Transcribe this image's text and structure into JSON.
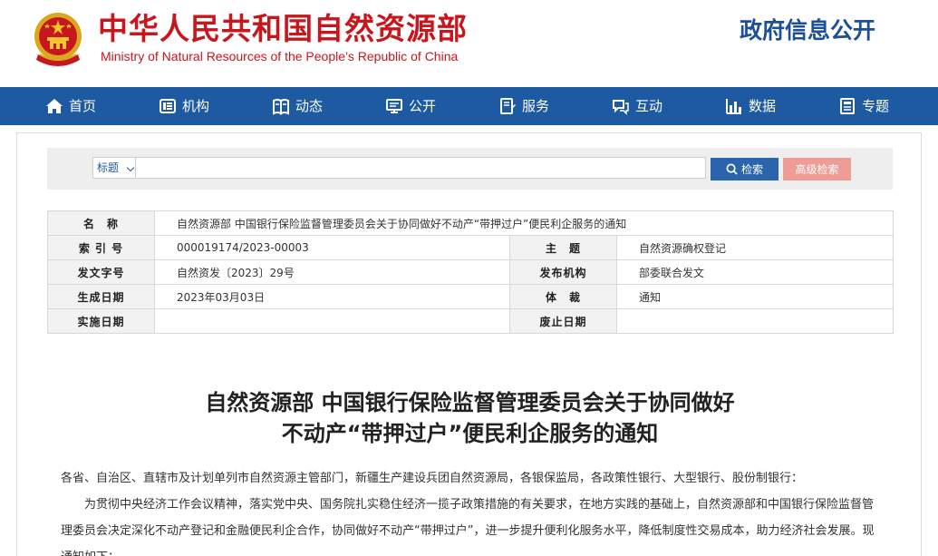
{
  "header": {
    "title": "中华人民共和国自然资源部",
    "subtitle": "Ministry of Natural Resources of the People’s Republic of China",
    "gov_info": "政府信息公开"
  },
  "nav": {
    "items": [
      {
        "label": "首页",
        "icon": "home-icon"
      },
      {
        "label": "机构",
        "icon": "institution-icon"
      },
      {
        "label": "动态",
        "icon": "book-icon"
      },
      {
        "label": "公开",
        "icon": "monitor-icon"
      },
      {
        "label": "服务",
        "icon": "document-edit-icon"
      },
      {
        "label": "互动",
        "icon": "chat-icon"
      },
      {
        "label": "数据",
        "icon": "bar-chart-icon"
      },
      {
        "label": "专题",
        "icon": "topic-icon"
      }
    ]
  },
  "search": {
    "field_select": "标题",
    "query": "",
    "search_label": "检索",
    "advanced_label": "高级检索"
  },
  "meta": {
    "name_label": "名　称",
    "name_value": "自然资源部 中国银行保险监督管理委员会关于协同做好不动产“带押过户”便民利企服务的通知",
    "index_label": "索 引 号",
    "index_value": "000019174/2023-00003",
    "topic_label": "主　题",
    "topic_value": "自然资源确权登记",
    "doc_no_label": "发文字号",
    "doc_no_value": "自然资发〔2023〕29号",
    "issuer_label": "发布机构",
    "issuer_value": "部委联合发文",
    "date_label": "生成日期",
    "date_value": "2023年03月03日",
    "genre_label": "体　裁",
    "genre_value": "通知",
    "effective_label": "实施日期",
    "effective_value": "",
    "abolish_label": "废止日期",
    "abolish_value": ""
  },
  "article": {
    "title_line1": "自然资源部 中国银行保险监督管理委员会关于协同做好",
    "title_line2": "不动产“带押过户”便民利企服务的通知",
    "salutation": "各省、自治区、直辖市及计划单列市自然资源主管部门，新疆生产建设兵团自然资源局，各银保监局，各政策性银行、大型银行、股份制银行：",
    "paragraph1": "为贯彻中央经济工作会议精神，落实党中央、国务院扎实稳住经济一揽子政策措施的有关要求，在地方实践的基础上，自然资源部和中国银行保险监督管理委员会决定深化不动产登记和金融便民利企合作，协同做好不动产“带押过户”，进一步提升便利化服务水平，降低制度性交易成本，助力经济社会发展。现通知如下："
  },
  "colors": {
    "brand_red": "#c8161d",
    "nav_blue": "#1d5aa1",
    "search_blue": "#2a64ad",
    "advanced_pink": "#f09c96"
  }
}
